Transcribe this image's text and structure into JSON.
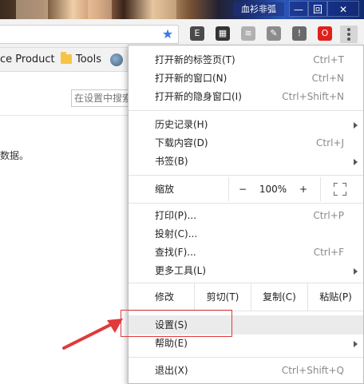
{
  "window": {
    "title_user": "血衫非弧",
    "buttons": [
      "—",
      "回",
      "✕"
    ]
  },
  "toolbar": {
    "bookmark_star": "★",
    "extensions": [
      {
        "name": "evernote-icon",
        "glyph": "E",
        "color": "#4a4a4a"
      },
      {
        "name": "qr-code-icon",
        "glyph": "▦",
        "color": "#333333"
      },
      {
        "name": "rss-icon",
        "glyph": "≋",
        "color": "#b0b0b0"
      },
      {
        "name": "compass-icon",
        "glyph": "✎",
        "color": "#8c8c8c"
      },
      {
        "name": "shield-extension-icon",
        "glyph": "!",
        "color": "#6a6a6a"
      },
      {
        "name": "opera-icon",
        "glyph": "O",
        "color": "#e0201b"
      }
    ]
  },
  "bookmarks": {
    "items": [
      {
        "label": "ce Product"
      },
      {
        "label": "Tools"
      }
    ]
  },
  "page": {
    "search_placeholder": "在设置中搜索",
    "text_fragment": "数据。"
  },
  "menu": {
    "new_tab": {
      "label": "打开新的标签页(T)",
      "shortcut": "Ctrl+T"
    },
    "new_window": {
      "label": "打开新的窗口(N)",
      "shortcut": "Ctrl+N"
    },
    "new_incognito": {
      "label": "打开新的隐身窗口(I)",
      "shortcut": "Ctrl+Shift+N"
    },
    "history": {
      "label": "历史记录(H)"
    },
    "downloads": {
      "label": "下载内容(D)",
      "shortcut": "Ctrl+J"
    },
    "bookmarks": {
      "label": "书签(B)"
    },
    "zoom": {
      "label": "缩放",
      "minus": "−",
      "value": "100%",
      "plus": "+"
    },
    "print": {
      "label": "打印(P)...",
      "shortcut": "Ctrl+P"
    },
    "cast": {
      "label": "投射(C)..."
    },
    "find": {
      "label": "查找(F)...",
      "shortcut": "Ctrl+F"
    },
    "more_tools": {
      "label": "更多工具(L)"
    },
    "edit": {
      "label": "修改",
      "cut": "剪切(T)",
      "copy": "复制(C)",
      "paste": "粘贴(P)"
    },
    "settings": {
      "label": "设置(S)"
    },
    "help": {
      "label": "帮助(E)"
    },
    "exit": {
      "label": "退出(X)",
      "shortcut": "Ctrl+Shift+Q"
    }
  },
  "annotation": {
    "color": "#e03a3a"
  }
}
